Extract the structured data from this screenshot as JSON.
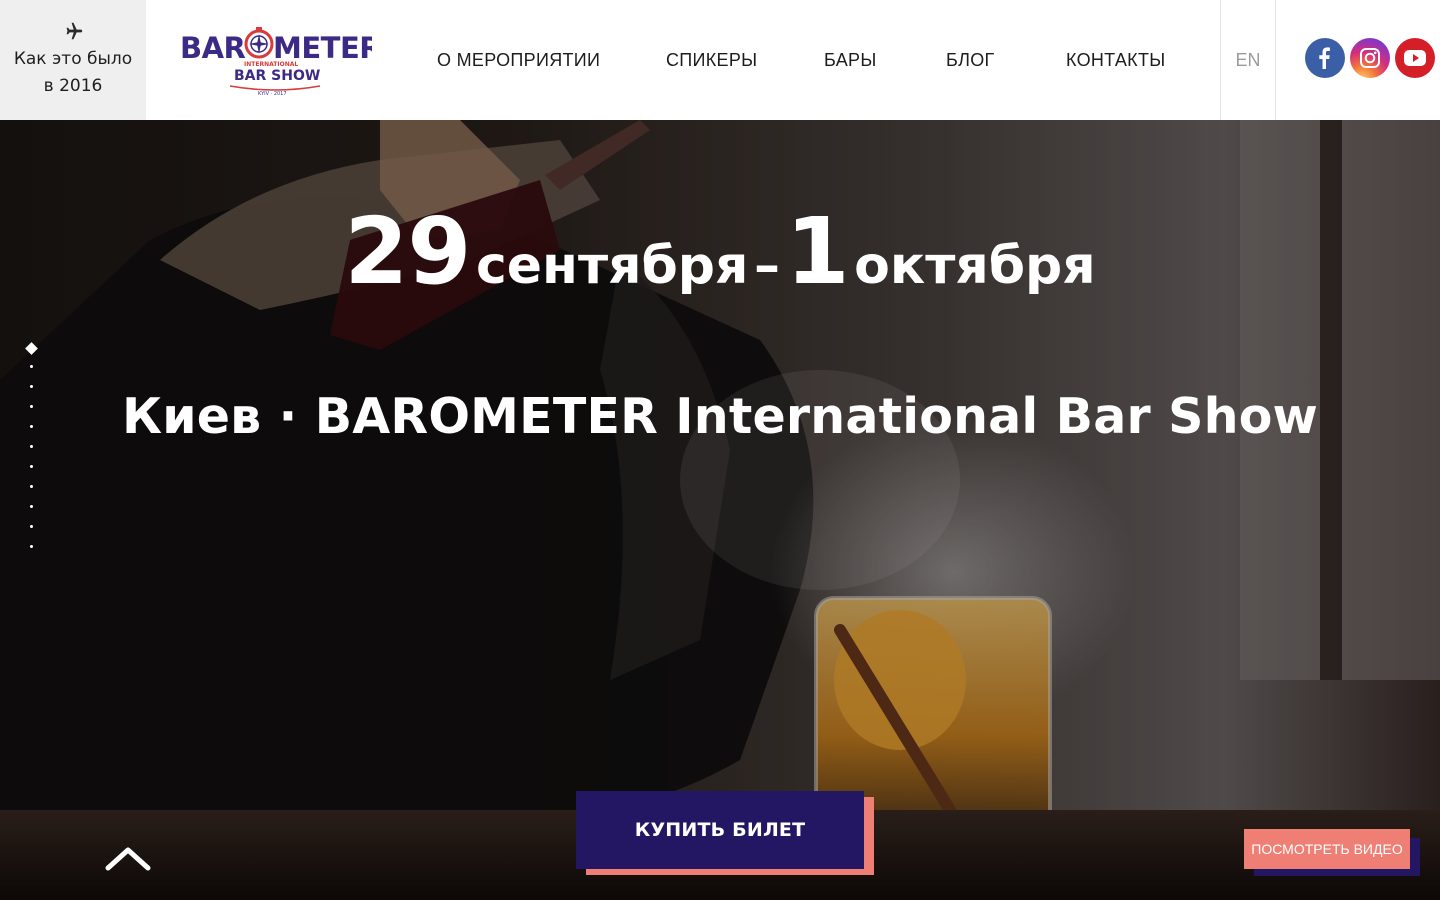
{
  "header": {
    "back_link": {
      "label": "Как это было в 2016",
      "icon": "airplane-icon"
    },
    "logo": {
      "word": "BAROMETER",
      "international": "INTERNATIONAL",
      "bar_show": "BAR SHOW",
      "edition": "KYIV · 2017"
    },
    "nav": [
      {
        "label": "О МЕРОПРИЯТИИ"
      },
      {
        "label": "СПИКЕРЫ"
      },
      {
        "label": "БАРЫ"
      },
      {
        "label": "БЛОГ"
      },
      {
        "label": "КОНТАКТЫ"
      }
    ],
    "language": "EN",
    "social": [
      {
        "name": "facebook-icon",
        "color": "#3b5fa6"
      },
      {
        "name": "instagram-icon",
        "color": "#d42e7c"
      },
      {
        "name": "youtube-icon",
        "color": "#d41e28"
      }
    ]
  },
  "hero": {
    "date": {
      "start_day": "29",
      "start_month": "сентября",
      "separator": "–",
      "end_day": "1",
      "end_month": "октября"
    },
    "subtitle": "Киев · BAROMETER International Bar Show",
    "slides": {
      "count": 11,
      "active": 0
    },
    "buy_button": "КУПИТЬ БИЛЕТ",
    "video_button": "ПОСМОТРЕТЬ ВИДЕО"
  },
  "colors": {
    "brand_navy": "#231763",
    "brand_coral": "#ef7e74",
    "logo_purple": "#3b2a86",
    "logo_red": "#d93a3a"
  }
}
